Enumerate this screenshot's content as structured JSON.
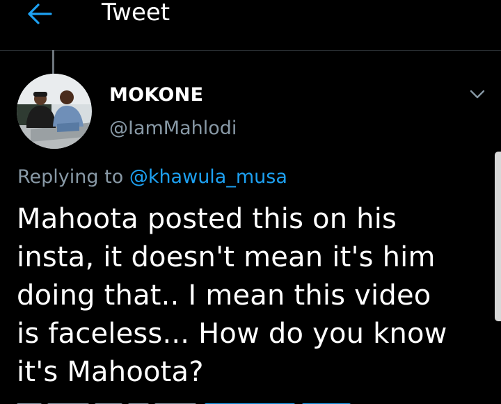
{
  "header": {
    "title": "Tweet",
    "back_icon": "arrow-left-icon"
  },
  "colors": {
    "background": "#000000",
    "accent": "#1da1f2",
    "secondary_text": "#8899a6",
    "divider": "#2a2f33"
  },
  "tweet": {
    "author": {
      "display_name": "MOKONE",
      "handle": "@IamMahlodi",
      "avatar_icon": "user-avatar-photo"
    },
    "more_icon": "chevron-down-icon",
    "replying_prefix": "Replying to ",
    "replying_to": "@khawula_musa",
    "text_lines": [
      "Mahoota posted this on his",
      "insta, it doesn't mean it's him",
      "doing that.. I mean this video",
      "is faceless... How do you know",
      "it's Mahoota?"
    ]
  }
}
